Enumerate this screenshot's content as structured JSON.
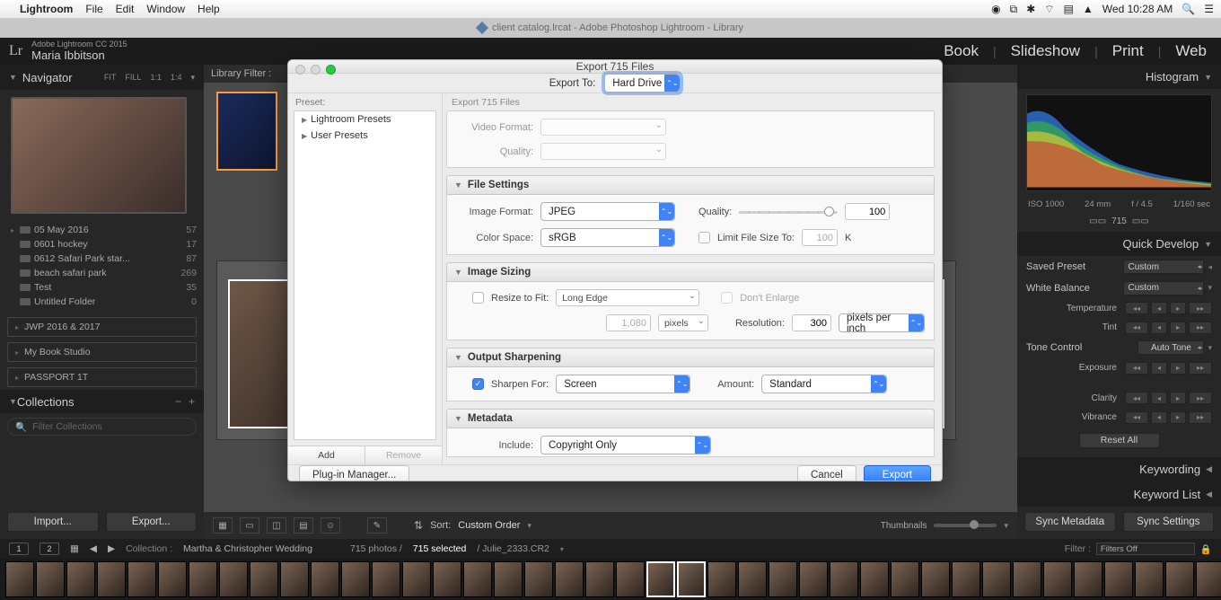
{
  "mac_menu": {
    "app": "Lightroom",
    "items": [
      "File",
      "Edit",
      "Window",
      "Help"
    ],
    "clock": "Wed 10:28 AM"
  },
  "lr_titlebar": "client catalog.lrcat - Adobe Photoshop Lightroom - Library",
  "identity": {
    "product": "Adobe Lightroom CC 2015",
    "user": "Maria Ibbitson"
  },
  "modules": [
    "Book",
    "Slideshow",
    "Print",
    "Web"
  ],
  "navigator": {
    "title": "Navigator",
    "modes": [
      "FIT",
      "FILL",
      "1:1",
      "1:4"
    ]
  },
  "folders": [
    {
      "name": "05 May 2016",
      "count": 57
    },
    {
      "name": "0601 hockey",
      "count": 17
    },
    {
      "name": "0612 Safari Park star...",
      "count": 87
    },
    {
      "name": "beach safari park",
      "count": 269
    },
    {
      "name": "Test",
      "count": 35
    },
    {
      "name": "Untitled Folder",
      "count": 0
    }
  ],
  "devices": [
    "JWP 2016 & 2017",
    "My Book Studio",
    "PASSPORT 1T"
  ],
  "collections": {
    "title": "Collections",
    "placeholder": "Filter Collections"
  },
  "buttons": {
    "import": "Import...",
    "export": "Export..."
  },
  "libfilter": "Library Filter :",
  "toolbar": {
    "sort_label": "Sort:",
    "sort_value": "Custom Order",
    "thumb_label": "Thumbnails"
  },
  "right": {
    "histogram": "Histogram",
    "meta": {
      "iso": "ISO 1000",
      "focal": "24 mm",
      "aperture": "f / 4.5",
      "shutter": "1/160 sec"
    },
    "selected_badge": "715",
    "quick_develop": "Quick Develop",
    "saved_preset_label": "Saved Preset",
    "saved_preset_value": "Custom",
    "wb_label": "White Balance",
    "wb_value": "Custom",
    "sliders": {
      "temperature": "Temperature",
      "tint": "Tint",
      "tone_control": "Tone Control",
      "auto_tone": "Auto Tone",
      "exposure": "Exposure",
      "clarity": "Clarity",
      "vibrance": "Vibrance"
    },
    "reset": "Reset All",
    "keywording": "Keywording",
    "keyword_list": "Keyword List"
  },
  "sync": {
    "meta": "Sync Metadata",
    "settings": "Sync Settings"
  },
  "infobar": {
    "display1": "1",
    "display2": "2",
    "collection_label": "Collection :",
    "collection_name": "Martha & Christopher Wedding",
    "count_text": "715 photos /",
    "selected_text": "715 selected",
    "file_text": "/ Julie_2333.CR2",
    "filter_label": "Filter :",
    "filter_value": "Filters Off"
  },
  "dialog": {
    "title": "Export 715 Files",
    "export_to_label": "Export To:",
    "export_to_value": "Hard Drive",
    "preset_label": "Preset:",
    "presets": [
      "Lightroom Presets",
      "User Presets"
    ],
    "preset_add": "Add",
    "preset_remove": "Remove",
    "sub_label": "Export 715 Files",
    "video": {
      "format_label": "Video Format:",
      "quality_label": "Quality:"
    },
    "file_settings": {
      "title": "File Settings",
      "image_format_label": "Image Format:",
      "image_format": "JPEG",
      "quality_label": "Quality:",
      "quality": "100",
      "color_space_label": "Color Space:",
      "color_space": "sRGB",
      "limit_label": "Limit File Size To:",
      "limit_value": "100",
      "limit_unit": "K"
    },
    "image_sizing": {
      "title": "Image Sizing",
      "resize_label": "Resize to Fit:",
      "resize_value": "Long Edge",
      "dont_enlarge": "Don't Enlarge",
      "dim": "1,080",
      "dim_unit": "pixels",
      "res_label": "Resolution:",
      "res": "300",
      "res_unit": "pixels per inch"
    },
    "sharpening": {
      "title": "Output Sharpening",
      "sharpen_for_label": "Sharpen For:",
      "sharpen_for": "Screen",
      "amount_label": "Amount:",
      "amount": "Standard"
    },
    "metadata": {
      "title": "Metadata",
      "include_label": "Include:",
      "include_value": "Copyright Only"
    },
    "plugin_manager": "Plug-in Manager...",
    "cancel": "Cancel",
    "export": "Export"
  }
}
